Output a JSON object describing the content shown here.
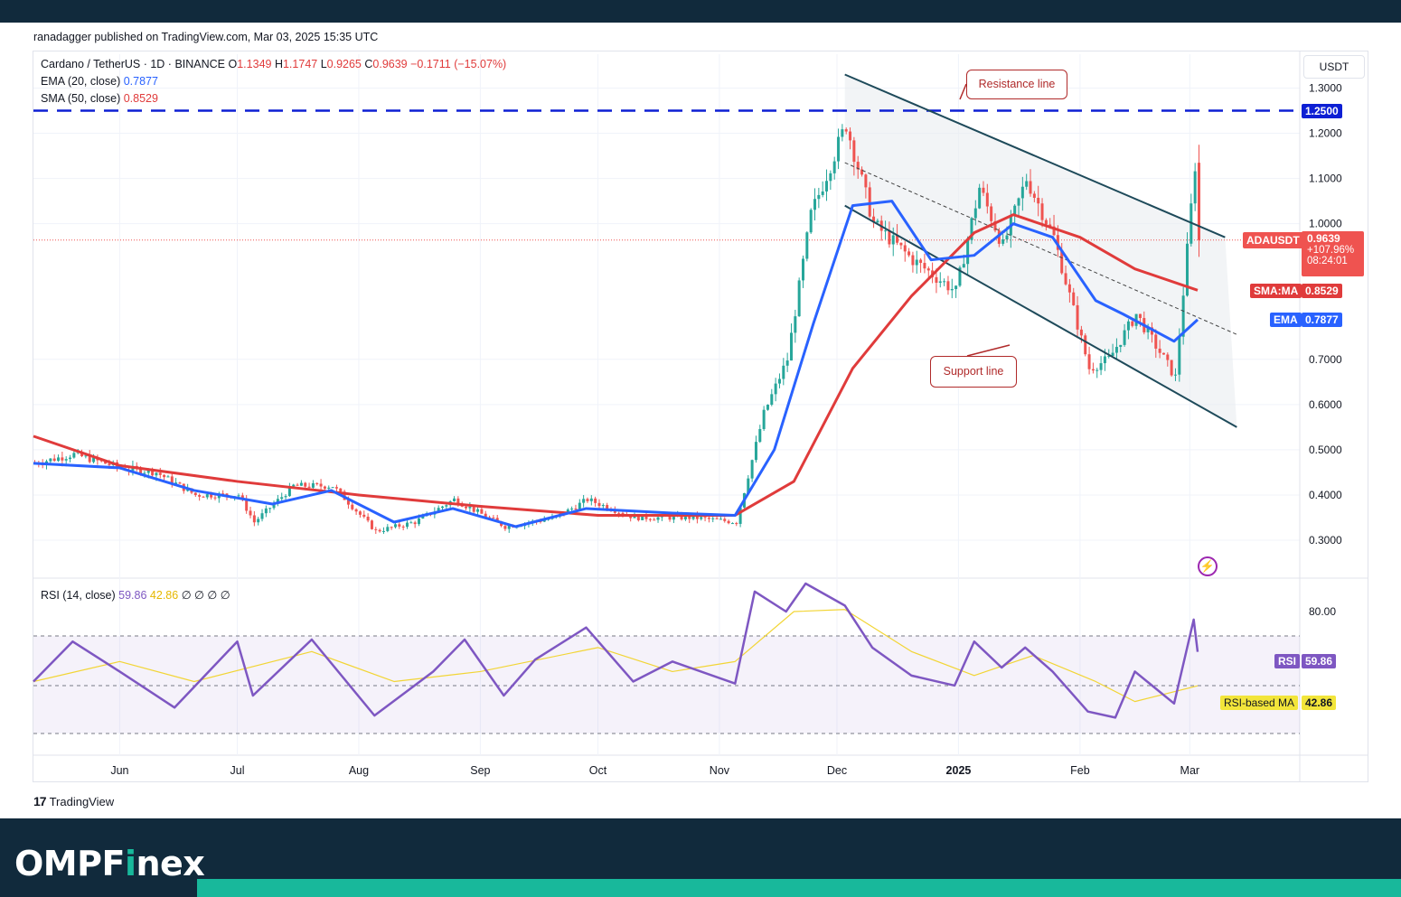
{
  "header": {
    "published": "ranadagger published on TradingView.com, Mar 03, 2025 15:35 UTC"
  },
  "legend": {
    "symbol": "Cardano / TetherUS · 1D · BINANCE",
    "o_label": "O",
    "o_val": "1.1349",
    "h_label": "H",
    "h_val": "1.1747",
    "l_label": "L",
    "l_val": "0.9265",
    "c_label": "C",
    "c_val": "0.9639",
    "change": "−0.1711 (−15.07%)",
    "ema_label": "EMA (20, close)",
    "ema_val": "0.7877",
    "sma_label": "SMA (50, close)",
    "sma_val": "0.8529",
    "rsi_label": "RSI (14, close)",
    "rsi_val": "59.86",
    "rsi_ma_val": "42.86",
    "rsi_extra": "∅ ∅ ∅ ∅"
  },
  "currency": "USDT",
  "tags": {
    "level": "1.2500",
    "symbol_name": "ADAUSDT",
    "symbol_price": "0.9639",
    "symbol_change": "+107.96%",
    "symbol_countdown": "08:24:01",
    "sma_name": "SMA:MA",
    "sma_price": "0.8529",
    "ema_name": "EMA",
    "ema_price": "0.7877",
    "rsi_name": "RSI",
    "rsi_price": "59.86",
    "rsi_ma_name": "RSI-based MA",
    "rsi_ma_price": "42.86"
  },
  "callouts": {
    "resistance": "Resistance line",
    "support": "Support line"
  },
  "colors": {
    "candle_up": "#26a69a",
    "candle_down": "#ef5350",
    "ema": "#2962ff",
    "sma": "#e03b3b",
    "rsi": "#7e57c2",
    "rsi_ma": "#f2d535",
    "channel": "#1e4a5a",
    "level_line": "#0d1fd4",
    "brand_green": "#18b89b",
    "brand_dark": "#112a3c"
  },
  "chart_data": {
    "type": "candlestick",
    "title": "Cardano / TetherUS · 1D · BINANCE",
    "ylabel": "USDT",
    "ylim": [
      0.23,
      1.38
    ],
    "yticks": [
      "1.3000",
      "1.2000",
      "1.1000",
      "1.0000",
      "0.7000",
      "0.6000",
      "0.5000",
      "0.4000",
      "0.3000"
    ],
    "ytick_values": [
      1.3,
      1.2,
      1.1,
      1.0,
      0.7,
      0.6,
      0.5,
      0.4,
      0.3
    ],
    "xticks": [
      "Jun",
      "Jul",
      "Aug",
      "Sep",
      "Oct",
      "Nov",
      "Dec",
      "2025",
      "Feb",
      "Mar"
    ],
    "x_start": "2024-05-10",
    "x_end": "2025-03-03",
    "horizontal_level": 1.25,
    "last_close": 0.9639,
    "price_points": [
      [
        "2024-05-10",
        0.47
      ],
      [
        "2024-05-20",
        0.49
      ],
      [
        "2024-06-01",
        0.46
      ],
      [
        "2024-06-10",
        0.45
      ],
      [
        "2024-06-20",
        0.4
      ],
      [
        "2024-07-01",
        0.4
      ],
      [
        "2024-07-05",
        0.34
      ],
      [
        "2024-07-15",
        0.42
      ],
      [
        "2024-07-25",
        0.42
      ],
      [
        "2024-08-05",
        0.32
      ],
      [
        "2024-08-15",
        0.34
      ],
      [
        "2024-08-25",
        0.39
      ],
      [
        "2024-09-07",
        0.33
      ],
      [
        "2024-09-20",
        0.35
      ],
      [
        "2024-09-28",
        0.39
      ],
      [
        "2024-10-10",
        0.35
      ],
      [
        "2024-10-25",
        0.35
      ],
      [
        "2024-11-05",
        0.34
      ],
      [
        "2024-11-12",
        0.58
      ],
      [
        "2024-11-18",
        0.7
      ],
      [
        "2024-11-24",
        1.02
      ],
      [
        "2024-12-03",
        1.22
      ],
      [
        "2024-12-10",
        1.0
      ],
      [
        "2024-12-20",
        0.92
      ],
      [
        "2024-12-31",
        0.85
      ],
      [
        "2025-01-06",
        1.08
      ],
      [
        "2025-01-12",
        0.95
      ],
      [
        "2025-01-18",
        1.1
      ],
      [
        "2025-01-25",
        0.97
      ],
      [
        "2025-02-03",
        0.68
      ],
      [
        "2025-02-08",
        0.7
      ],
      [
        "2025-02-15",
        0.8
      ],
      [
        "2025-02-25",
        0.66
      ],
      [
        "2025-03-02",
        1.13
      ],
      [
        "2025-03-03",
        0.9639
      ]
    ],
    "ema20_points": [
      [
        "2024-05-10",
        0.47
      ],
      [
        "2024-06-01",
        0.46
      ],
      [
        "2024-06-20",
        0.41
      ],
      [
        "2024-07-10",
        0.38
      ],
      [
        "2024-07-25",
        0.41
      ],
      [
        "2024-08-10",
        0.34
      ],
      [
        "2024-08-25",
        0.37
      ],
      [
        "2024-09-10",
        0.33
      ],
      [
        "2024-09-28",
        0.37
      ],
      [
        "2024-10-20",
        0.36
      ],
      [
        "2024-11-05",
        0.355
      ],
      [
        "2024-11-15",
        0.5
      ],
      [
        "2024-11-25",
        0.78
      ],
      [
        "2024-12-05",
        1.04
      ],
      [
        "2024-12-15",
        1.05
      ],
      [
        "2024-12-25",
        0.92
      ],
      [
        "2025-01-05",
        0.93
      ],
      [
        "2025-01-15",
        1.0
      ],
      [
        "2025-01-25",
        0.97
      ],
      [
        "2025-02-05",
        0.83
      ],
      [
        "2025-02-12",
        0.8
      ],
      [
        "2025-02-25",
        0.74
      ],
      [
        "2025-03-03",
        0.7877
      ]
    ],
    "sma50_points": [
      [
        "2024-05-10",
        0.53
      ],
      [
        "2024-06-01",
        0.465
      ],
      [
        "2024-07-01",
        0.43
      ],
      [
        "2024-08-01",
        0.4
      ],
      [
        "2024-09-01",
        0.375
      ],
      [
        "2024-10-01",
        0.355
      ],
      [
        "2024-11-05",
        0.355
      ],
      [
        "2024-11-20",
        0.43
      ],
      [
        "2024-12-05",
        0.68
      ],
      [
        "2024-12-20",
        0.84
      ],
      [
        "2025-01-05",
        0.98
      ],
      [
        "2025-01-15",
        1.02
      ],
      [
        "2025-02-01",
        0.97
      ],
      [
        "2025-02-15",
        0.9
      ],
      [
        "2025-03-03",
        0.8529
      ]
    ],
    "channel": {
      "upper": [
        [
          "2024-12-03",
          1.33
        ],
        [
          "2025-03-10",
          0.97
        ]
      ],
      "lower": [
        [
          "2024-12-03",
          1.04
        ],
        [
          "2025-03-13",
          0.55
        ]
      ],
      "mid": [
        [
          "2024-12-03",
          1.135
        ],
        [
          "2025-03-13",
          0.755
        ]
      ]
    },
    "rsi": {
      "ylim": [
        20,
        95
      ],
      "yticks": [
        "80.00"
      ],
      "ytick_values": [
        80
      ],
      "bands": [
        70,
        50,
        30
      ],
      "rsi_points": [
        [
          "2024-05-10",
          45
        ],
        [
          "2024-05-20",
          65
        ],
        [
          "2024-06-01",
          50
        ],
        [
          "2024-06-15",
          32
        ],
        [
          "2024-07-01",
          65
        ],
        [
          "2024-07-05",
          38
        ],
        [
          "2024-07-20",
          66
        ],
        [
          "2024-08-05",
          28
        ],
        [
          "2024-08-20",
          50
        ],
        [
          "2024-08-28",
          66
        ],
        [
          "2024-09-07",
          38
        ],
        [
          "2024-09-15",
          56
        ],
        [
          "2024-09-28",
          72
        ],
        [
          "2024-10-10",
          45
        ],
        [
          "2024-10-20",
          55
        ],
        [
          "2024-11-05",
          44
        ],
        [
          "2024-11-10",
          90
        ],
        [
          "2024-11-18",
          80
        ],
        [
          "2024-11-23",
          94
        ],
        [
          "2024-12-03",
          83
        ],
        [
          "2024-12-10",
          62
        ],
        [
          "2024-12-20",
          48
        ],
        [
          "2024-12-31",
          43
        ],
        [
          "2025-01-05",
          65
        ],
        [
          "2025-01-12",
          52
        ],
        [
          "2025-01-18",
          62
        ],
        [
          "2025-01-25",
          50
        ],
        [
          "2025-02-03",
          30
        ],
        [
          "2025-02-10",
          27
        ],
        [
          "2025-02-15",
          50
        ],
        [
          "2025-02-25",
          34
        ],
        [
          "2025-03-02",
          76
        ],
        [
          "2025-03-03",
          59.86
        ]
      ],
      "ma_points": [
        [
          "2024-05-10",
          45
        ],
        [
          "2024-06-01",
          55
        ],
        [
          "2024-06-20",
          45
        ],
        [
          "2024-07-20",
          60
        ],
        [
          "2024-08-10",
          45
        ],
        [
          "2024-09-01",
          50
        ],
        [
          "2024-10-01",
          62
        ],
        [
          "2024-10-20",
          50
        ],
        [
          "2024-11-05",
          55
        ],
        [
          "2024-11-20",
          80
        ],
        [
          "2024-12-03",
          81
        ],
        [
          "2024-12-20",
          60
        ],
        [
          "2025-01-05",
          48
        ],
        [
          "2025-01-20",
          58
        ],
        [
          "2025-02-05",
          45
        ],
        [
          "2025-02-15",
          35
        ],
        [
          "2025-03-03",
          42.86
        ]
      ]
    }
  }
}
